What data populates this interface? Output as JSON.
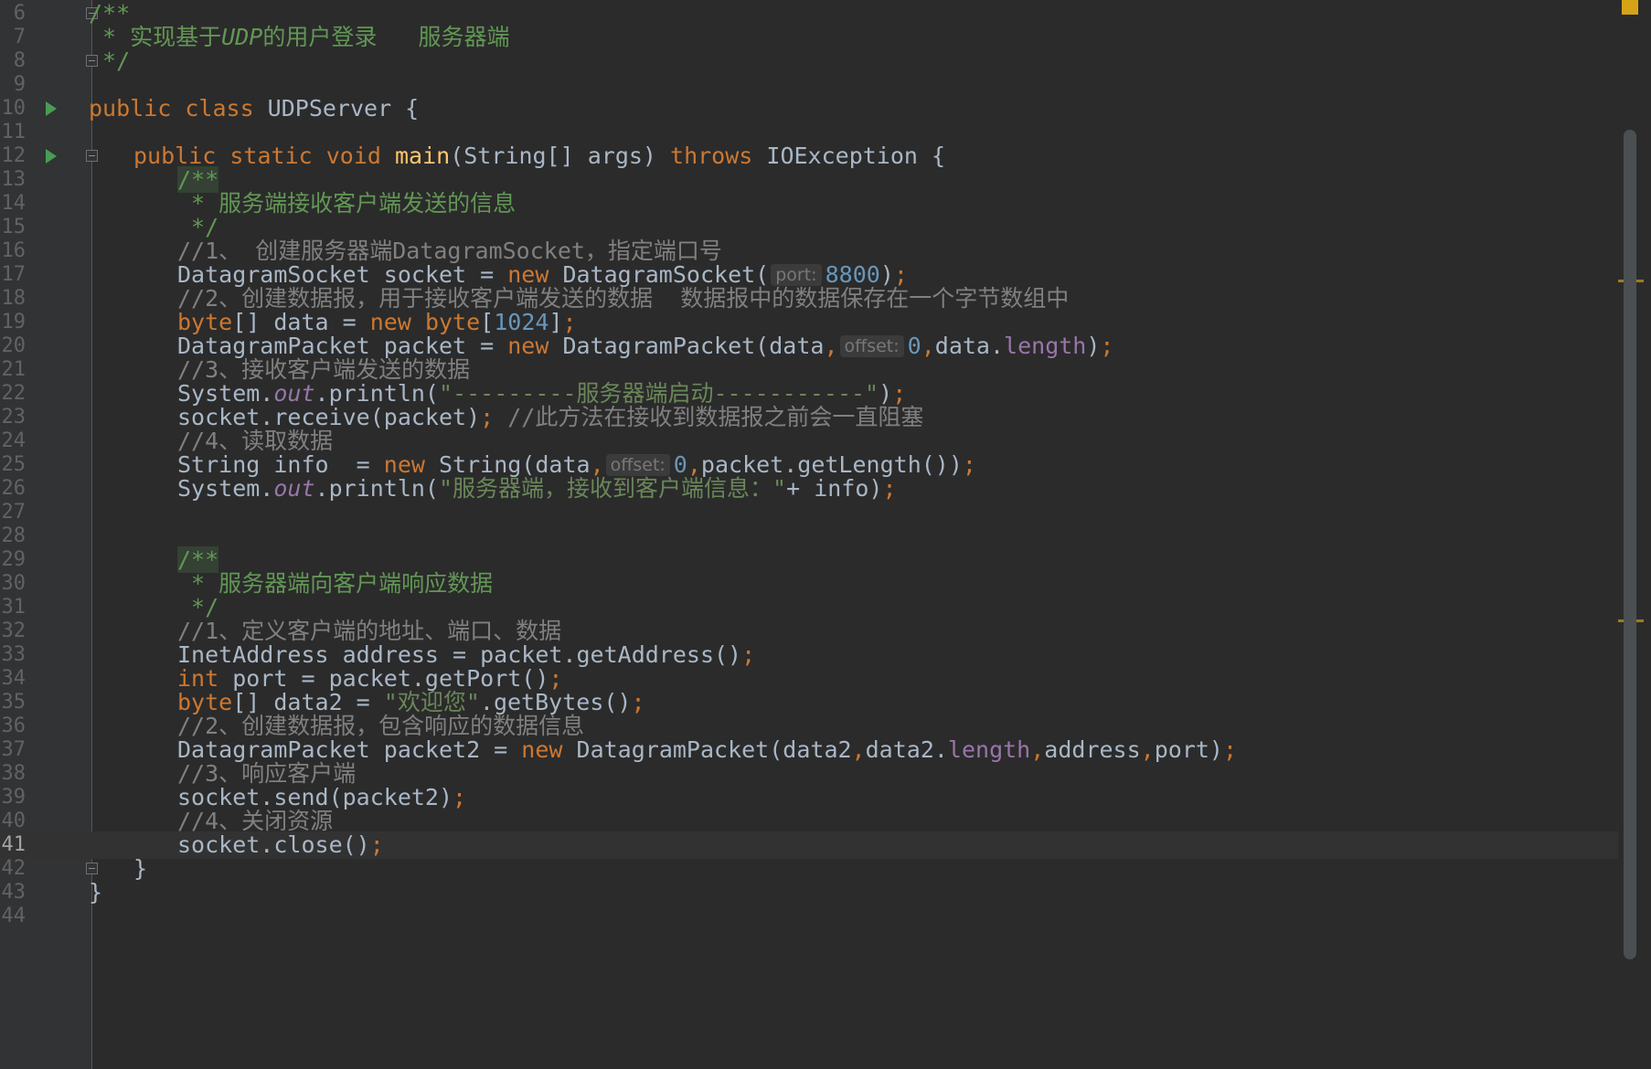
{
  "editor": {
    "colors": {
      "background": "#2b2b2b",
      "keyword": "#cc7832",
      "comment": "#808080",
      "doc_comment": "#629755",
      "string": "#6a8759",
      "number": "#6897bb",
      "field": "#9876aa",
      "method_declaration": "#ffc66d",
      "run_marker": "#499c54",
      "error_stripe": "#d7a316"
    },
    "current_line": "41",
    "lines": [
      {
        "n": "6"
      },
      {
        "n": "7"
      },
      {
        "n": "8"
      },
      {
        "n": "9"
      },
      {
        "n": "10"
      },
      {
        "n": "11"
      },
      {
        "n": "12"
      },
      {
        "n": "13"
      },
      {
        "n": "14"
      },
      {
        "n": "15"
      },
      {
        "n": "16"
      },
      {
        "n": "17"
      },
      {
        "n": "18"
      },
      {
        "n": "19"
      },
      {
        "n": "20"
      },
      {
        "n": "21"
      },
      {
        "n": "22"
      },
      {
        "n": "23"
      },
      {
        "n": "24"
      },
      {
        "n": "25"
      },
      {
        "n": "26"
      },
      {
        "n": "27"
      },
      {
        "n": "28"
      },
      {
        "n": "29"
      },
      {
        "n": "30"
      },
      {
        "n": "31"
      },
      {
        "n": "32"
      },
      {
        "n": "33"
      },
      {
        "n": "34"
      },
      {
        "n": "35"
      },
      {
        "n": "36"
      },
      {
        "n": "37"
      },
      {
        "n": "38"
      },
      {
        "n": "39"
      },
      {
        "n": "40"
      },
      {
        "n": "41"
      },
      {
        "n": "42"
      },
      {
        "n": "43"
      },
      {
        "n": "44"
      }
    ],
    "code": {
      "l6": {
        "t1": "/**"
      },
      "l7": {
        "t1": " * 实现基于",
        "t2": "UDP",
        "t3": "的用户登录   服务器端"
      },
      "l8": {
        "t1": " */"
      },
      "l10": {
        "t1": "public class ",
        "t2": "UDPServer {"
      },
      "l12": {
        "t1": "public static void ",
        "t2": "main",
        "t3": "(String[] args) ",
        "t4": "throws ",
        "t5": "IOException {"
      },
      "l13": {
        "t1": "/**"
      },
      "l14": {
        "t1": " * 服务端接收客户端发送的信息"
      },
      "l15": {
        "t1": " */"
      },
      "l16": {
        "t1": "//1、 创建服务器端DatagramSocket，指定端口号"
      },
      "l17": {
        "t1": "DatagramSocket socket = ",
        "t2": "new ",
        "t3": "DatagramSocket(",
        "hint": "port:",
        "t4": "8800",
        "t5": ")",
        "t6": ";"
      },
      "l18": {
        "t1": "//2、创建数据报，用于接收客户端发送的数据  数据报中的数据保存在一个字节数组中"
      },
      "l19": {
        "t1": "byte",
        "t2": "[] data = ",
        "t3": "new ",
        "t4": "byte",
        "t5": "[",
        "t6": "1024",
        "t7": "]",
        "t8": ";"
      },
      "l20": {
        "t1": "DatagramPacket packet = ",
        "t2": "new ",
        "t3": "DatagramPacket(data",
        "t4": ",",
        "hint": "offset:",
        "t5": "0",
        "t6": ",",
        "t7": "data.",
        "t8": "length",
        "t9": ")",
        "t10": ";"
      },
      "l21": {
        "t1": "//3、接收客户端发送的数据"
      },
      "l22": {
        "t1": "System.",
        "t2": "out",
        "t3": ".println(",
        "t4": "\"---------服务器端启动-----------\"",
        "t5": ")",
        "t6": ";"
      },
      "l23": {
        "t1": "socket.receive(packet)",
        "t2": "; ",
        "t3": "//此方法在接收到数据报之前会一直阻塞"
      },
      "l24": {
        "t1": "//4、读取数据"
      },
      "l25": {
        "t1": "String info  = ",
        "t2": "new ",
        "t3": "String(data",
        "t4": ",",
        "hint": "offset:",
        "t5": "0",
        "t6": ",",
        "t7": "packet.getLength())",
        "t8": ";"
      },
      "l26": {
        "t1": "System.",
        "t2": "out",
        "t3": ".println(",
        "t4": "\"服务器端，接收到客户端信息：\"",
        "t5": "+ info)",
        "t6": ";"
      },
      "l29": {
        "t1": "/**"
      },
      "l30": {
        "t1": " * 服务器端向客户端响应数据"
      },
      "l31": {
        "t1": " */"
      },
      "l32": {
        "t1": "//1、定义客户端的地址、端口、数据"
      },
      "l33": {
        "t1": "InetAddress address = packet.getAddress()",
        "t2": ";"
      },
      "l34": {
        "t1": "int ",
        "t2": "port = packet.getPort()",
        "t3": ";"
      },
      "l35": {
        "t1": "byte",
        "t2": "[] data2 = ",
        "t3": "\"欢迎您\"",
        "t4": ".getBytes()",
        "t5": ";"
      },
      "l36": {
        "t1": "//2、创建数据报，包含响应的数据信息"
      },
      "l37": {
        "t1": "DatagramPacket packet2 = ",
        "t2": "new ",
        "t3": "DatagramPacket(data2",
        "t4": ",",
        "t5": "data2.",
        "t6": "length",
        "t7": ",",
        "t8": "address",
        "t9": ",",
        "t10": "port)",
        "t11": ";"
      },
      "l38": {
        "t1": "//3、响应客户端"
      },
      "l39": {
        "t1": "socket.send(packet2)",
        "t2": ";"
      },
      "l40": {
        "t1": "//4、关闭资源"
      },
      "l41": {
        "t1": "socket.close()",
        "t2": ";"
      },
      "l42": {
        "t1": "}"
      },
      "l43": {
        "t1": "}"
      }
    }
  }
}
